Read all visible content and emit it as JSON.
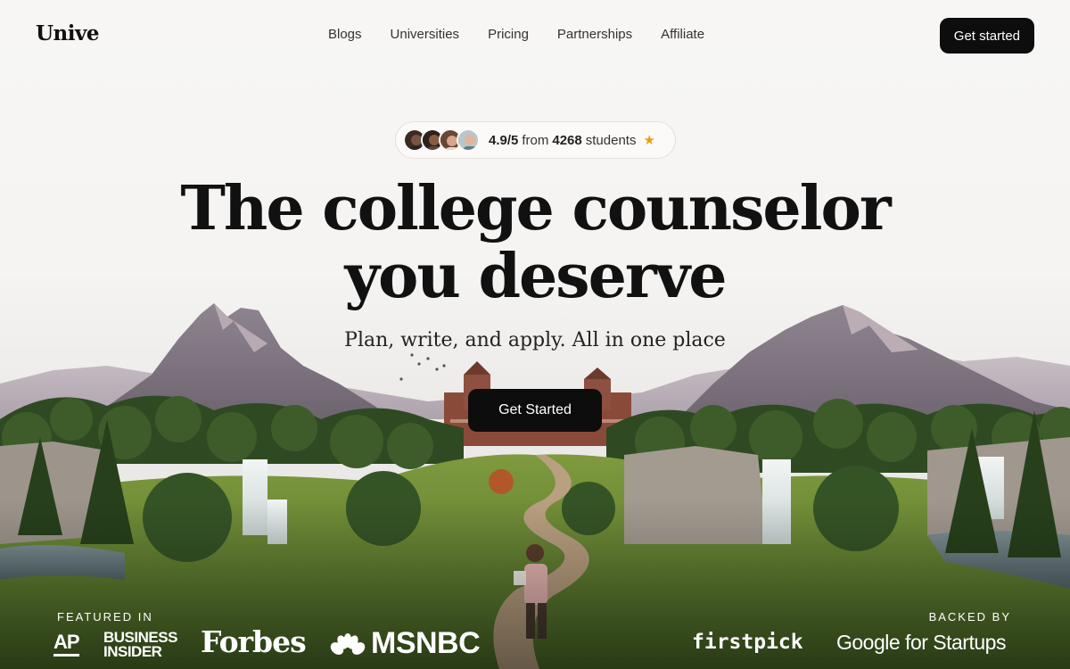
{
  "brand": {
    "name": "Unive"
  },
  "nav": {
    "links": [
      "Blogs",
      "Universities",
      "Pricing",
      "Partnerships",
      "Affiliate"
    ],
    "cta": "Get started"
  },
  "rating": {
    "score": "4.9/5",
    "from": "from",
    "count": "4268",
    "suffix": "students",
    "star_color": "#e8a10f"
  },
  "hero": {
    "title_line1": "The college counselor",
    "title_line2": "you deserve",
    "subtitle": "Plan, write, and apply. All in one place",
    "cta": "Get Started"
  },
  "featured": {
    "label": "FEATURED IN",
    "logos": [
      "AP",
      "BUSINESS INSIDER",
      "Forbes",
      "MSNBC"
    ]
  },
  "backed": {
    "label": "BACKED BY",
    "logos": [
      "firstpick",
      "Google for Startups"
    ]
  },
  "colors": {
    "background": "#f7f6f4",
    "button": "#0d0d0d",
    "text": "#111111"
  }
}
